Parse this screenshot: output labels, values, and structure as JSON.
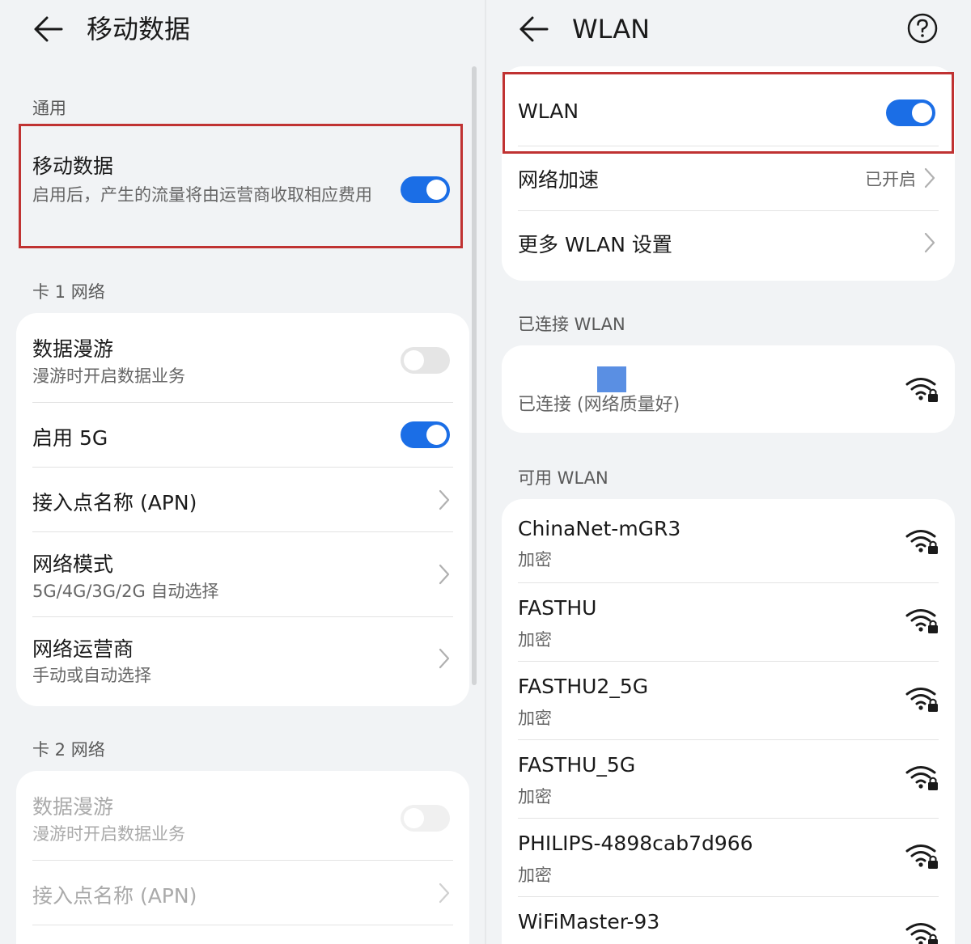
{
  "left": {
    "header": {
      "title": "移动数据"
    },
    "general": {
      "section_label": "通用",
      "mobile_data": {
        "title": "移动数据",
        "subtitle": "启用后，产生的流量将由运营商收取相应费用",
        "enabled": true
      }
    },
    "sim1": {
      "section_label": "卡 1 网络",
      "items": [
        {
          "title": "数据漫游",
          "subtitle": "漫游时开启数据业务",
          "toggle": false
        },
        {
          "title": "启用 5G",
          "toggle": true
        },
        {
          "title": "接入点名称 (APN)"
        },
        {
          "title": "网络模式",
          "subtitle": "5G/4G/3G/2G 自动选择"
        },
        {
          "title": "网络运营商",
          "subtitle": "手动或自动选择"
        }
      ]
    },
    "sim2": {
      "section_label": "卡 2 网络",
      "items": [
        {
          "title": "数据漫游",
          "subtitle": "漫游时开启数据业务",
          "toggle": false,
          "disabled": true
        },
        {
          "title": "接入点名称 (APN)",
          "disabled": true
        }
      ]
    }
  },
  "right": {
    "header": {
      "title": "WLAN"
    },
    "wlan_toggle": {
      "title": "WLAN",
      "enabled": true
    },
    "acceleration": {
      "title": "网络加速",
      "value": "已开启"
    },
    "more_settings": {
      "title": "更多 WLAN 设置"
    },
    "connected": {
      "section_label": "已连接 WLAN",
      "status": "已连接 (网络质量好)"
    },
    "available": {
      "section_label": "可用 WLAN",
      "networks": [
        {
          "ssid": "ChinaNet-mGR3",
          "security": "加密"
        },
        {
          "ssid": "FASTHU",
          "security": "加密"
        },
        {
          "ssid": "FASTHU2_5G",
          "security": "加密"
        },
        {
          "ssid": "FASTHU_5G",
          "security": "加密"
        },
        {
          "ssid": "PHILIPS-4898cab7d966",
          "security": "加密"
        },
        {
          "ssid": "WiFiMaster-93"
        }
      ]
    }
  },
  "colors": {
    "accent": "#1b6ee6",
    "highlight": "#c03232",
    "background": "#f1f3f5"
  }
}
